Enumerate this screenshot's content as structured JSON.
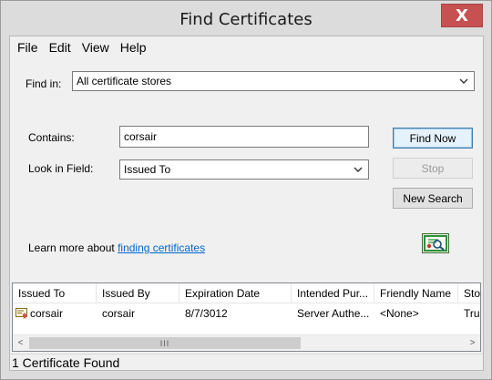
{
  "window": {
    "title": "Find Certificates",
    "close_glyph": "X"
  },
  "menu": [
    {
      "label": "File"
    },
    {
      "label": "Edit"
    },
    {
      "label": "View"
    },
    {
      "label": "Help"
    }
  ],
  "form": {
    "find_in_label": "Find in:",
    "find_in_value": "All certificate stores",
    "contains_label": "Contains:",
    "contains_value": "corsair",
    "look_in_label": "Look in Field:",
    "look_in_value": "Issued To"
  },
  "buttons": {
    "find_now": "Find Now",
    "stop": "Stop",
    "new_search": "New Search"
  },
  "learn_more": {
    "prefix": "Learn more about ",
    "link": "finding certificates"
  },
  "table": {
    "columns": [
      "Issued To",
      "Issued By",
      "Expiration Date",
      "Intended Pur...",
      "Friendly Name",
      "Store"
    ],
    "rows": [
      {
        "cells": [
          "corsair",
          "corsair",
          "8/7/3012",
          "Server Authe...",
          "<None>",
          "Trus"
        ]
      }
    ]
  },
  "scrollbar": {
    "thumb_grip": "III",
    "left_arrow": "<",
    "right_arrow": ">"
  },
  "status": "1 Certificate Found",
  "icons": [
    "close-icon",
    "chevron-down-icon",
    "certificate-icon",
    "certificate-search-icon"
  ]
}
